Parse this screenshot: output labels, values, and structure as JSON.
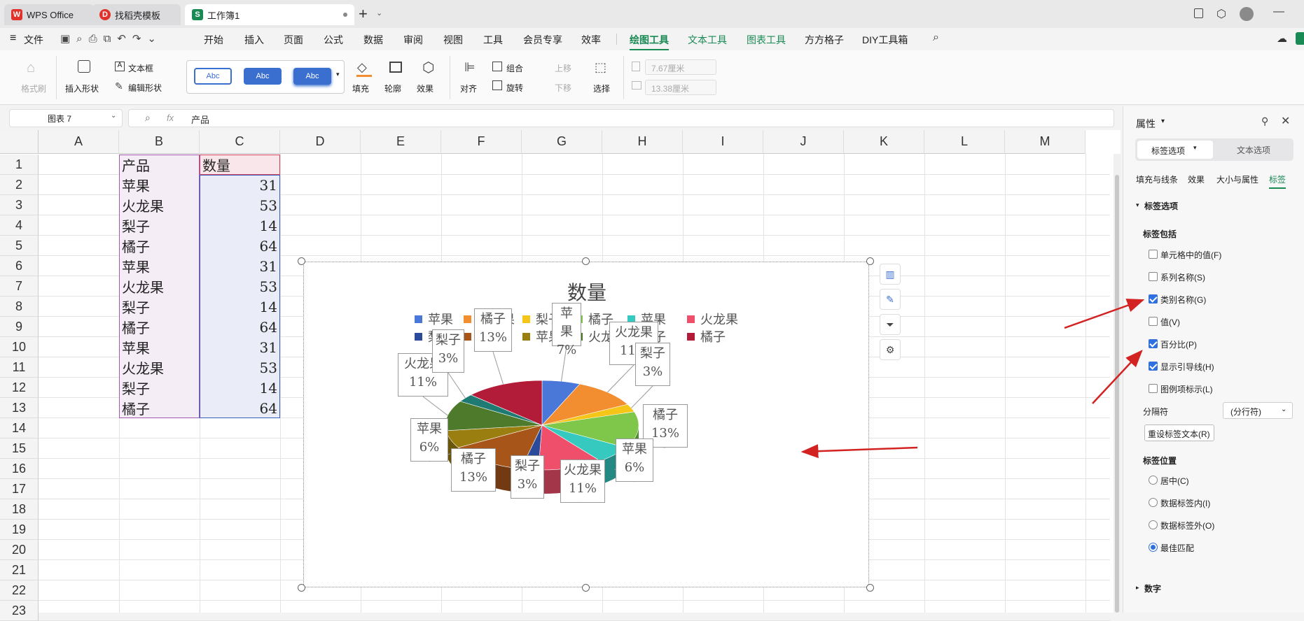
{
  "tabs": [
    {
      "label": "WPS Office"
    },
    {
      "label": "找稻壳模板"
    },
    {
      "label": "工作簿1"
    }
  ],
  "menu": {
    "file": "文件",
    "items": [
      "开始",
      "插入",
      "页面",
      "公式",
      "数据",
      "审阅",
      "视图",
      "工具",
      "会员专享",
      "效率"
    ],
    "context": [
      "绘图工具",
      "文本工具",
      "图表工具",
      "方方格子",
      "DIY工具箱"
    ]
  },
  "ribbon": {
    "format_painter": "格式刷",
    "insert_shape": "插入形状",
    "textbox": "文本框",
    "edit_shape": "编辑形状",
    "style_sample": "Abc",
    "fill": "填充",
    "outline": "轮廓",
    "effect": "效果",
    "align": "对齐",
    "group": "组合",
    "rotate": "旋转",
    "move_up": "上移",
    "move_down": "下移",
    "select": "选择",
    "width": "7.67厘米",
    "height": "13.38厘米"
  },
  "formula_bar": {
    "name_box": "图表 7",
    "fx": "fx",
    "content": "产品"
  },
  "columns": [
    "A",
    "B",
    "C",
    "D",
    "E",
    "F",
    "G",
    "H",
    "I",
    "J",
    "K",
    "L",
    "M"
  ],
  "rows": [
    "1",
    "2",
    "3",
    "4",
    "5",
    "6",
    "7",
    "8",
    "9",
    "10",
    "11",
    "12",
    "13",
    "14",
    "15",
    "16",
    "17",
    "18",
    "19",
    "20",
    "21",
    "22",
    "23"
  ],
  "table": {
    "header": [
      "产品",
      "数量"
    ],
    "rows": [
      [
        "苹果",
        "31"
      ],
      [
        "火龙果",
        "53"
      ],
      [
        "梨子",
        "14"
      ],
      [
        "橘子",
        "64"
      ],
      [
        "苹果",
        "31"
      ],
      [
        "火龙果",
        "53"
      ],
      [
        "梨子",
        "14"
      ],
      [
        "橘子",
        "64"
      ],
      [
        "苹果",
        "31"
      ],
      [
        "火龙果",
        "53"
      ],
      [
        "梨子",
        "14"
      ],
      [
        "橘子",
        "64"
      ]
    ]
  },
  "chart_data": {
    "type": "pie",
    "title": "数量",
    "categories": [
      "苹果",
      "火龙果",
      "梨子",
      "橘子",
      "苹果",
      "火龙果",
      "梨子",
      "橘子",
      "苹果",
      "火龙果",
      "梨子",
      "橘子"
    ],
    "values": [
      31,
      53,
      14,
      64,
      31,
      53,
      14,
      64,
      31,
      53,
      14,
      64
    ],
    "percent_labels": [
      "7%",
      "11%",
      "3%",
      "13%",
      "6%",
      "11%",
      "3%",
      "13%",
      "6%",
      "11%",
      "3%",
      "13%"
    ],
    "colors": [
      "#4a78d8",
      "#f28d30",
      "#f5c518",
      "#7ec74a",
      "#35c9c0",
      "#ef4f6b",
      "#2c4a9a",
      "#a8551a",
      "#9a7e10",
      "#4e7a2c",
      "#1f7a74",
      "#b31c38"
    ],
    "legend_position": "top",
    "style": "3d"
  },
  "panel": {
    "title": "属性",
    "tab_label": "标签选项",
    "tab_text": "文本选项",
    "subtabs": [
      "填充与线条",
      "效果",
      "大小与属性",
      "标签"
    ],
    "section": "标签选项",
    "includes_title": "标签包括",
    "checks": [
      {
        "label": "单元格中的值(F)",
        "checked": false
      },
      {
        "label": "系列名称(S)",
        "checked": false
      },
      {
        "label": "类别名称(G)",
        "checked": true
      },
      {
        "label": "值(V)",
        "checked": false
      },
      {
        "label": "百分比(P)",
        "checked": true
      },
      {
        "label": "显示引导线(H)",
        "checked": true
      },
      {
        "label": "图例项标示(L)",
        "checked": false
      }
    ],
    "separator_label": "分隔符",
    "separator_value": "(分行符)",
    "reset_button": "重设标签文本(R)",
    "position_title": "标签位置",
    "positions": [
      {
        "label": "居中(C)",
        "selected": false
      },
      {
        "label": "数据标签内(I)",
        "selected": false
      },
      {
        "label": "数据标签外(O)",
        "selected": false
      },
      {
        "label": "最佳匹配",
        "selected": true
      }
    ],
    "number_section": "数字"
  }
}
